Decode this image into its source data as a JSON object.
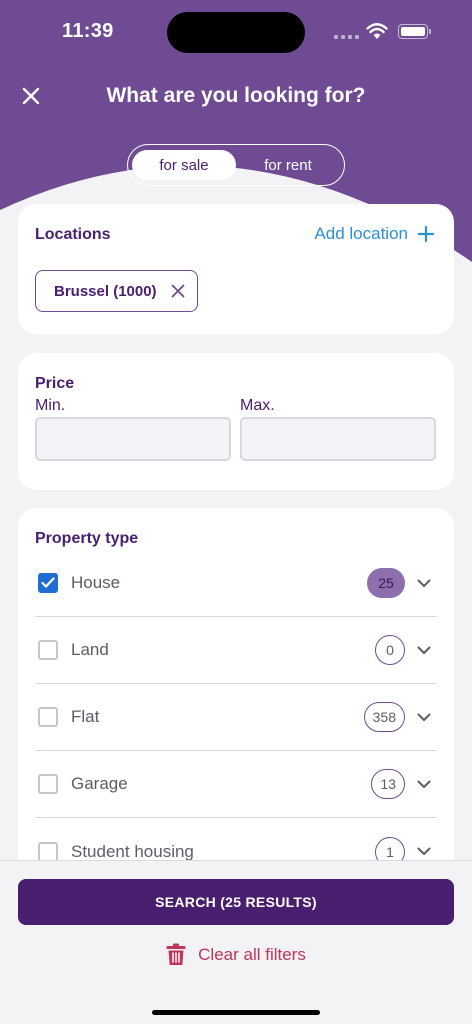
{
  "status_bar": {
    "time": "11:39"
  },
  "header": {
    "title": "What are you looking for?"
  },
  "toggle": {
    "options": [
      "for sale",
      "for rent"
    ],
    "selected": "for sale"
  },
  "locations": {
    "title": "Locations",
    "add_label": "Add location",
    "chips": [
      {
        "label": "Brussel (1000)"
      }
    ]
  },
  "price": {
    "title": "Price",
    "min_label": "Min.",
    "max_label": "Max.",
    "min_value": "",
    "max_value": ""
  },
  "property_type": {
    "title": "Property type",
    "items": [
      {
        "label": "House",
        "count": "25",
        "checked": true
      },
      {
        "label": "Land",
        "count": "0",
        "checked": false
      },
      {
        "label": "Flat",
        "count": "358",
        "checked": false
      },
      {
        "label": "Garage",
        "count": "13",
        "checked": false
      },
      {
        "label": "Student housing",
        "count": "1",
        "checked": false
      }
    ]
  },
  "actions": {
    "search_label": "SEARCH (25 RESULTS)",
    "clear_label": "Clear all filters"
  },
  "colors": {
    "primary": "#4a1e6e",
    "header_bg": "#6e4b92",
    "link": "#2b8fd6",
    "danger": "#c0355a",
    "checkbox": "#1e6ed4"
  }
}
